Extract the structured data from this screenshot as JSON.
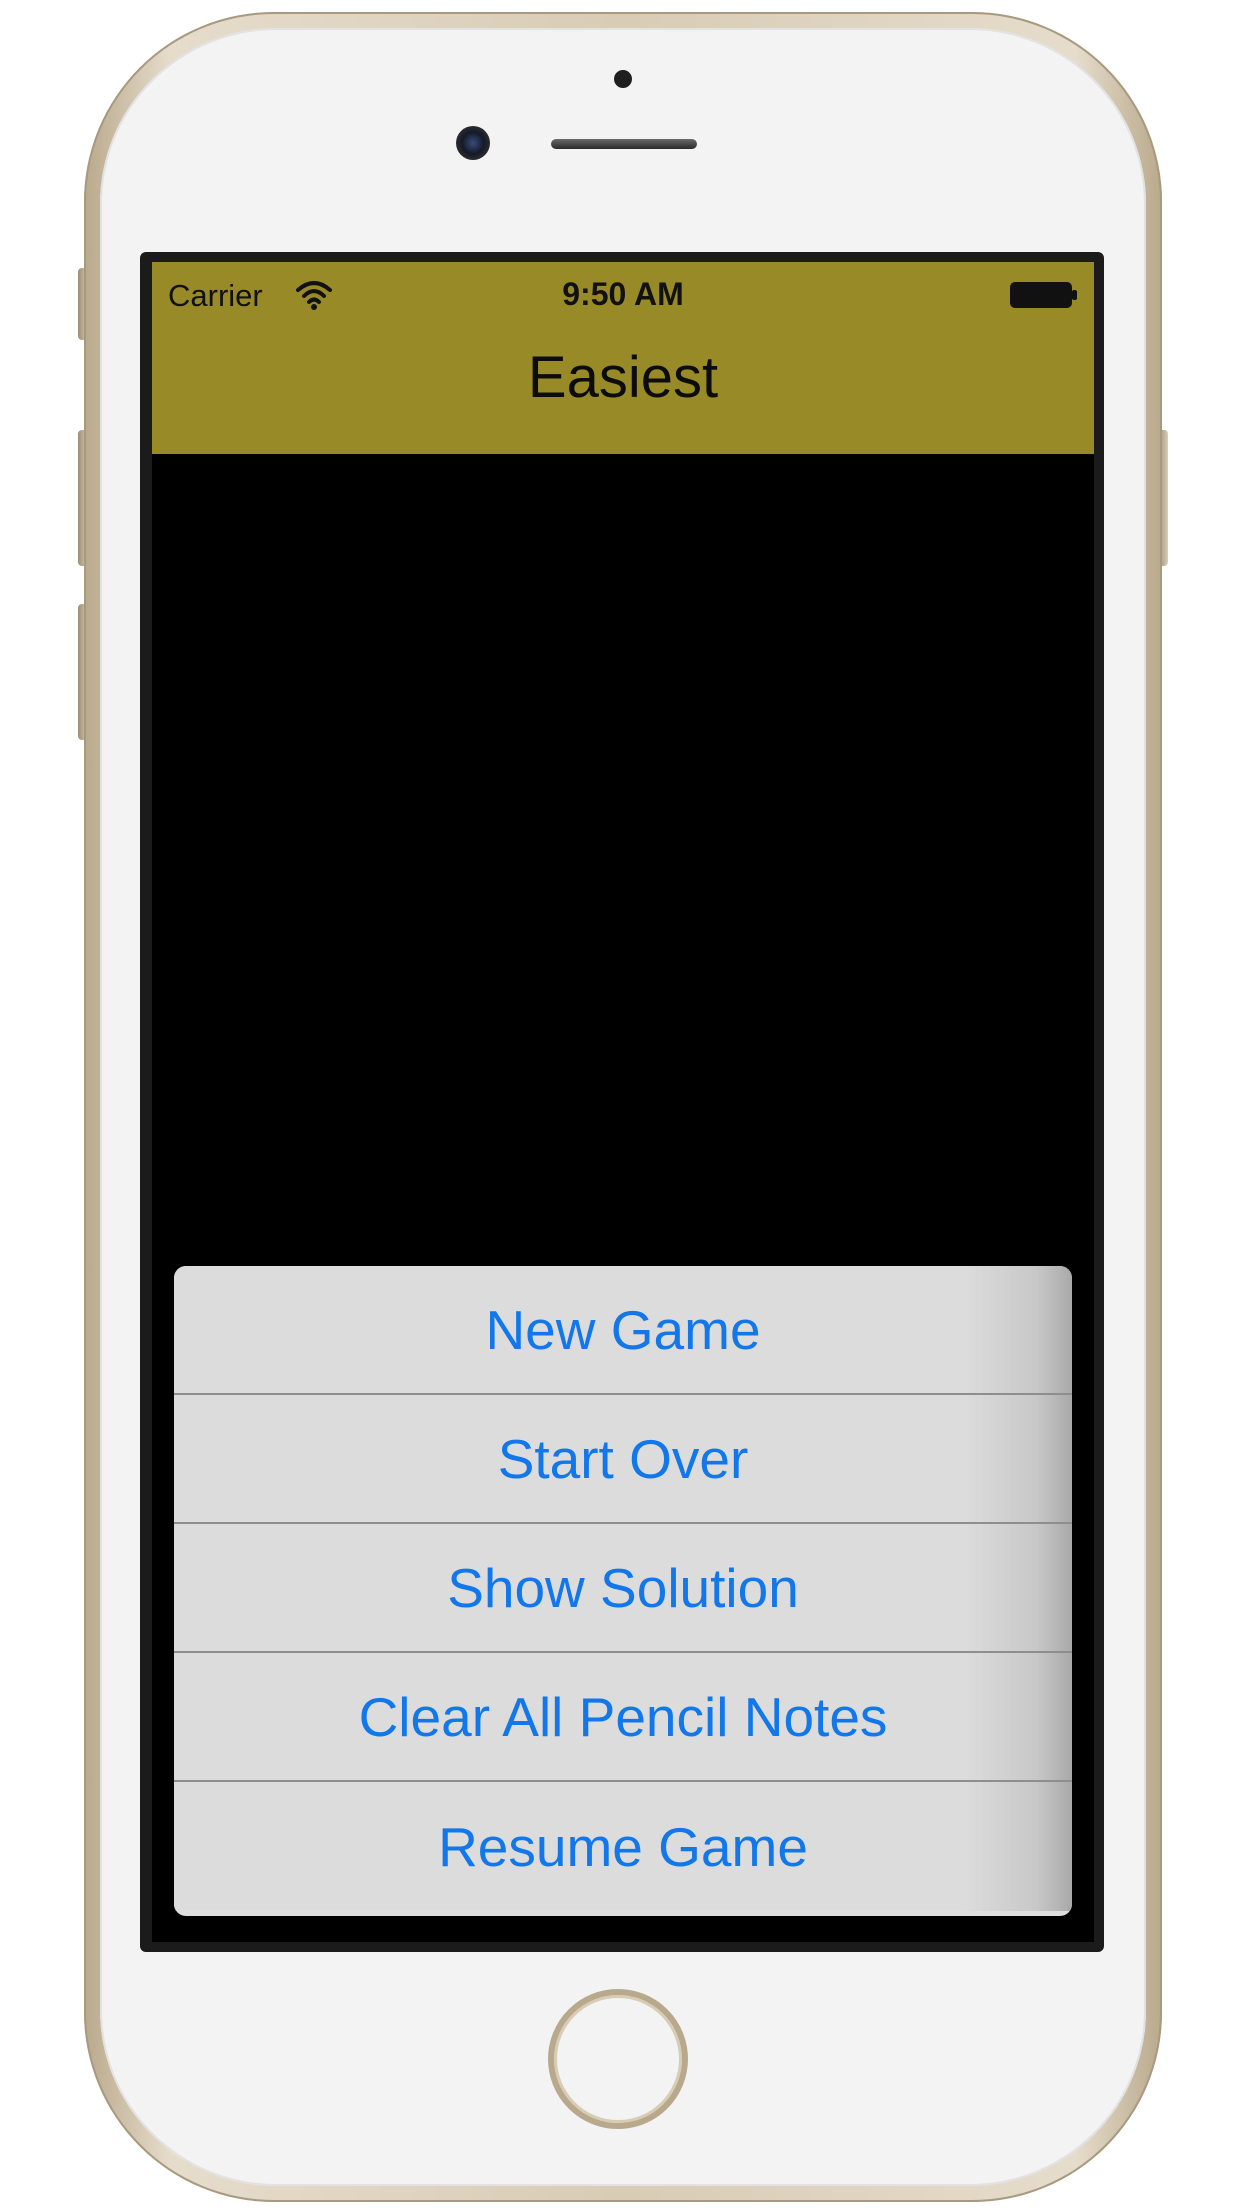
{
  "status_bar": {
    "carrier": "Carrier",
    "time": "9:50 AM",
    "wifi_icon": "wifi-icon",
    "battery_icon": "battery-icon"
  },
  "nav_bar": {
    "title": "Easiest",
    "color": "#998a28"
  },
  "action_sheet": {
    "items": [
      {
        "label": "New Game"
      },
      {
        "label": "Start Over"
      },
      {
        "label": "Show Solution"
      },
      {
        "label": "Clear All Pencil Notes"
      },
      {
        "label": "Resume Game"
      }
    ],
    "text_color": "#1277ea"
  },
  "device": {
    "home_button_icon": "home-button"
  }
}
